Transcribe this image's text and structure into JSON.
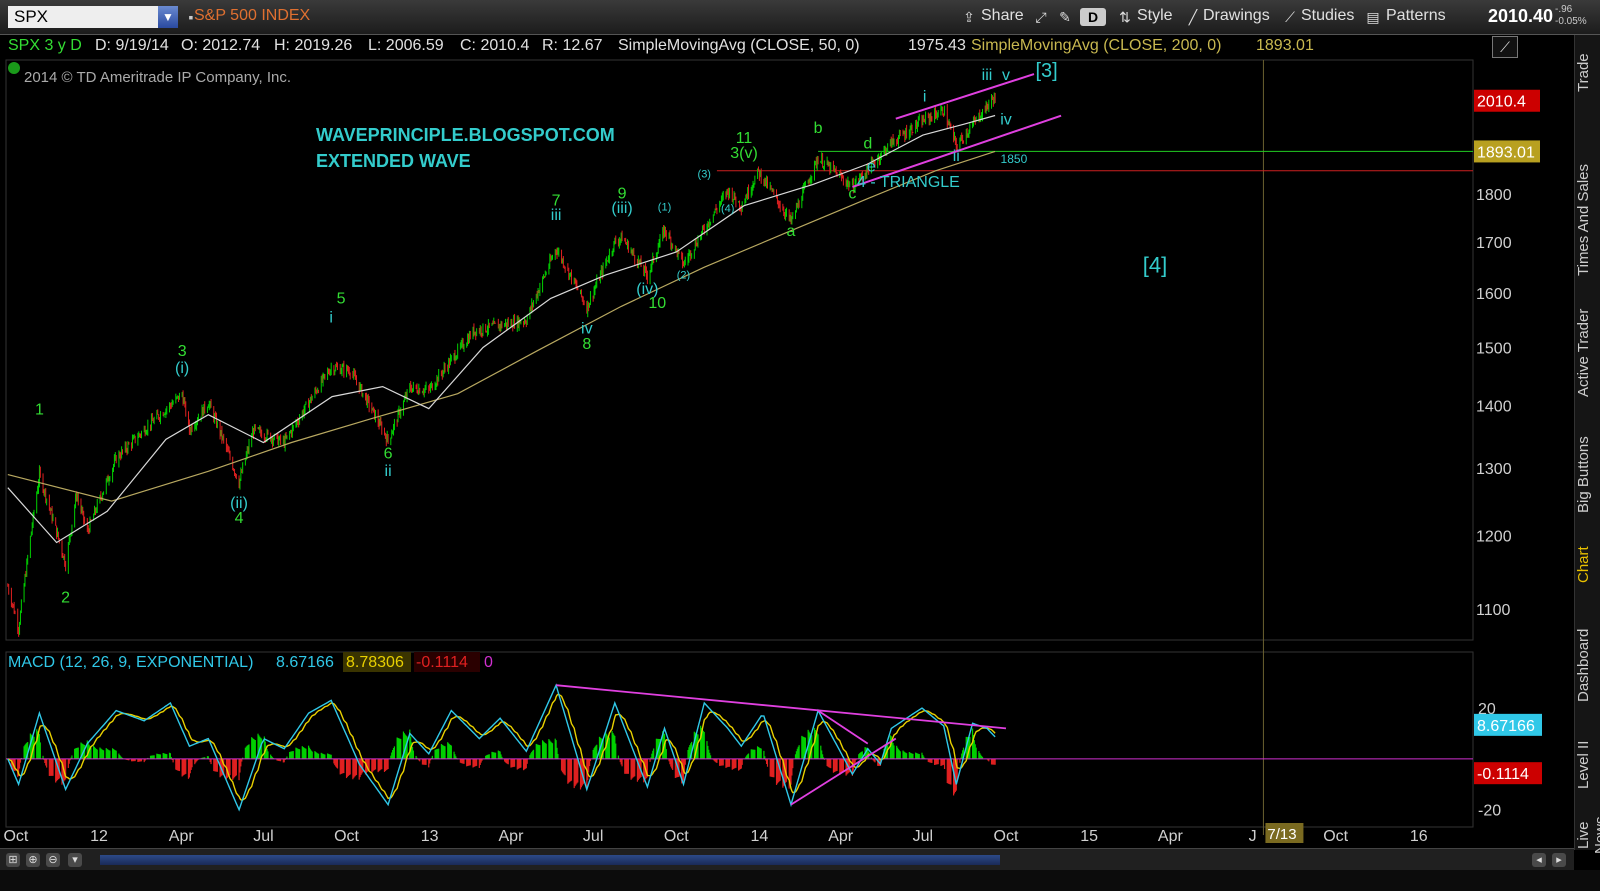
{
  "toolbar": {
    "symbol": "SPX",
    "index_name": "S&P 500 INDEX",
    "share": "Share",
    "style": "Style",
    "drawings": "Drawings",
    "studies": "Studies",
    "patterns": "Patterns",
    "last_price": "2010.40",
    "change": "-.96",
    "change_pct": "-0.05%",
    "d_badge": "D"
  },
  "header": {
    "tf": "SPX 3 y D",
    "date": "D: 9/19/14",
    "open": "O: 2012.74",
    "high": "H: 2019.26",
    "low": "L: 2006.59",
    "close": "C: 2010.4",
    "range": "R: 12.67",
    "sma50_label": "SimpleMovingAvg (CLOSE, 50, 0)",
    "sma50_val": "1975.43",
    "sma200_label": "SimpleMovingAvg (CLOSE, 200, 0)",
    "sma200_val": "1893.01"
  },
  "copyright": "2014 © TD Ameritrade IP Company, Inc.",
  "sidebar": [
    "Trade",
    "Times And Sales",
    "Active Trader",
    "Big Buttons",
    "Chart",
    "Dashboard",
    "Level II",
    "Live News"
  ],
  "colors": {
    "candle_up": "#00d000",
    "candle_down": "#e02020",
    "sma50": "#d8d8d8",
    "sma200": "#b8a860",
    "wave_green": "#33dd33",
    "wave_cyan": "#33cccc",
    "trend_magenta": "#e040e0",
    "macd_line": "#30c8e8",
    "signal_line": "#e8d000"
  },
  "chart_data": {
    "type": "candlestick",
    "price_axis": {
      "ticks": [
        1100,
        1200,
        1300,
        1400,
        1500,
        1600,
        1700,
        1800
      ],
      "ylim": [
        1060,
        2110
      ],
      "scale": "log"
    },
    "x_ticks": [
      "Oct",
      "12",
      "Apr",
      "Jul",
      "Oct",
      "13",
      "Apr",
      "Jul",
      "Oct",
      "14",
      "Apr",
      "Jul",
      "Oct",
      "15",
      "Apr",
      "J",
      "Oct",
      "16"
    ],
    "x_dates": [
      "2011-10-01",
      "2012-01-01",
      "2012-04-01",
      "2012-07-01",
      "2012-10-01",
      "2013-01-01",
      "2013-04-01",
      "2013-07-01",
      "2013-10-01",
      "2014-01-01",
      "2014-04-01",
      "2014-07-01",
      "2014-10-01",
      "2015-01-01",
      "2015-04-01",
      "2015-07-01",
      "2015-10-01",
      "2016-01-01"
    ],
    "xlim": [
      "2011-09-20",
      "2016-03-01"
    ],
    "last_date": "2014-09-19",
    "cursor_date": "7/13",
    "price_series": [
      [
        "2011-09-22",
        1130
      ],
      [
        "2011-10-04",
        1075
      ],
      [
        "2011-10-27",
        1290
      ],
      [
        "2011-11-25",
        1160
      ],
      [
        "2011-12-07",
        1260
      ],
      [
        "2011-12-19",
        1205
      ],
      [
        "2012-01-20",
        1315
      ],
      [
        "2012-03-01",
        1375
      ],
      [
        "2012-04-02",
        1419
      ],
      [
        "2012-04-10",
        1360
      ],
      [
        "2012-05-01",
        1405
      ],
      [
        "2012-06-04",
        1278
      ],
      [
        "2012-06-20",
        1360
      ],
      [
        "2012-07-24",
        1340
      ],
      [
        "2012-09-14",
        1465
      ],
      [
        "2012-10-05",
        1460
      ],
      [
        "2012-11-16",
        1343
      ],
      [
        "2012-12-10",
        1430
      ],
      [
        "2012-12-31",
        1426
      ],
      [
        "2013-02-19",
        1530
      ],
      [
        "2013-04-18",
        1550
      ],
      [
        "2013-05-21",
        1687
      ],
      [
        "2013-06-24",
        1573
      ],
      [
        "2013-07-25",
        1700
      ],
      [
        "2013-08-02",
        1709
      ],
      [
        "2013-08-30",
        1633
      ],
      [
        "2013-09-18",
        1725
      ],
      [
        "2013-10-09",
        1656
      ],
      [
        "2013-11-27",
        1807
      ],
      [
        "2013-12-12",
        1775
      ],
      [
        "2013-12-31",
        1848
      ],
      [
        "2014-02-05",
        1741
      ],
      [
        "2014-03-07",
        1878
      ],
      [
        "2014-04-14",
        1815
      ],
      [
        "2014-05-27",
        1912
      ],
      [
        "2014-06-30",
        1962
      ],
      [
        "2014-07-24",
        1988
      ],
      [
        "2014-08-07",
        1905
      ],
      [
        "2014-09-18",
        2019
      ],
      [
        "2014-09-19",
        2010.4
      ]
    ],
    "sma50_series": [
      [
        "2011-09-22",
        1270
      ],
      [
        "2011-11-15",
        1190
      ],
      [
        "2012-01-10",
        1235
      ],
      [
        "2012-03-15",
        1345
      ],
      [
        "2012-05-01",
        1385
      ],
      [
        "2012-07-01",
        1340
      ],
      [
        "2012-09-15",
        1415
      ],
      [
        "2012-11-10",
        1432
      ],
      [
        "2012-12-31",
        1395
      ],
      [
        "2013-03-01",
        1500
      ],
      [
        "2013-05-15",
        1590
      ],
      [
        "2013-07-15",
        1635
      ],
      [
        "2013-10-01",
        1680
      ],
      [
        "2013-12-15",
        1775
      ],
      [
        "2014-03-01",
        1820
      ],
      [
        "2014-05-01",
        1865
      ],
      [
        "2014-07-01",
        1930
      ],
      [
        "2014-08-15",
        1955
      ],
      [
        "2014-09-19",
        1975.43
      ]
    ],
    "sma200_series": [
      [
        "2011-09-22",
        1290
      ],
      [
        "2012-01-15",
        1250
      ],
      [
        "2012-05-01",
        1295
      ],
      [
        "2012-08-01",
        1340
      ],
      [
        "2012-11-01",
        1380
      ],
      [
        "2013-02-01",
        1420
      ],
      [
        "2013-05-01",
        1495
      ],
      [
        "2013-08-01",
        1575
      ],
      [
        "2013-11-01",
        1650
      ],
      [
        "2014-02-01",
        1720
      ],
      [
        "2014-05-01",
        1790
      ],
      [
        "2014-07-15",
        1850
      ],
      [
        "2014-09-19",
        1893.01
      ]
    ],
    "horizontal_lines": [
      {
        "value": 1893.01,
        "color": "#22cc22",
        "label": "1893.01"
      },
      {
        "value": 1850,
        "color": "#cc2020",
        "label": "1850",
        "label_text": "1850"
      }
    ],
    "price_labels": [
      {
        "value": 2010.4,
        "text": "2010.4",
        "bg": "#cc0000"
      },
      {
        "value": 1893.01,
        "text": "1893.01",
        "bg": "#b8a020"
      }
    ],
    "annotations": [
      {
        "date": "2011-10-27",
        "value": 1385,
        "text": "1",
        "color": "#33dd33",
        "size": 16
      },
      {
        "date": "2011-11-25",
        "value": 1108,
        "text": "2",
        "color": "#33dd33",
        "size": 16
      },
      {
        "date": "2012-04-02",
        "value": 1485,
        "text": "3",
        "color": "#33dd33",
        "size": 16
      },
      {
        "date": "2012-04-02",
        "value": 1455,
        "text": "(i)",
        "color": "#33cccc",
        "size": 16
      },
      {
        "date": "2012-06-04",
        "value": 1240,
        "text": "(ii)",
        "color": "#33cccc",
        "size": 16
      },
      {
        "date": "2012-06-04",
        "value": 1218,
        "text": "4",
        "color": "#33dd33",
        "size": 16
      },
      {
        "date": "2012-09-14",
        "value": 1545,
        "text": "i",
        "color": "#33cccc",
        "size": 16
      },
      {
        "date": "2012-09-25",
        "value": 1580,
        "text": "5",
        "color": "#33dd33",
        "size": 16
      },
      {
        "date": "2012-11-16",
        "value": 1315,
        "text": "6",
        "color": "#33dd33",
        "size": 16
      },
      {
        "date": "2012-11-16",
        "value": 1288,
        "text": "ii",
        "color": "#33cccc",
        "size": 16
      },
      {
        "date": "2013-05-21",
        "value": 1775,
        "text": "7",
        "color": "#33dd33",
        "size": 16
      },
      {
        "date": "2013-05-21",
        "value": 1745,
        "text": "iii",
        "color": "#33cccc",
        "size": 16
      },
      {
        "date": "2013-06-24",
        "value": 1525,
        "text": "iv",
        "color": "#33cccc",
        "size": 16
      },
      {
        "date": "2013-06-24",
        "value": 1497,
        "text": "8",
        "color": "#33dd33",
        "size": 16
      },
      {
        "date": "2013-08-02",
        "value": 1790,
        "text": "9",
        "color": "#33dd33",
        "size": 16
      },
      {
        "date": "2013-08-02",
        "value": 1760,
        "text": "(iii)",
        "color": "#33cccc",
        "size": 16
      },
      {
        "date": "2013-08-30",
        "value": 1598,
        "text": "(iv)",
        "color": "#33cccc",
        "size": 16
      },
      {
        "date": "2013-09-10",
        "value": 1572,
        "text": "10",
        "color": "#33dd33",
        "size": 16
      },
      {
        "date": "2013-09-18",
        "value": 1765,
        "text": "(1)",
        "color": "#33cccc",
        "size": 11
      },
      {
        "date": "2013-10-09",
        "value": 1628,
        "text": "(2)",
        "color": "#33cccc",
        "size": 11
      },
      {
        "date": "2013-11-01",
        "value": 1835,
        "text": "(3)",
        "color": "#33cccc",
        "size": 11
      },
      {
        "date": "2013-11-27",
        "value": 1762,
        "text": "(4)",
        "color": "#33cccc",
        "size": 11
      },
      {
        "date": "2013-12-15",
        "value": 1912,
        "text": "11",
        "color": "#33dd33",
        "size": 16
      },
      {
        "date": "2013-12-15",
        "value": 1878,
        "text": "3(v)",
        "color": "#33dd33",
        "size": 16
      },
      {
        "date": "2014-02-05",
        "value": 1712,
        "text": "a",
        "color": "#33dd33",
        "size": 16
      },
      {
        "date": "2014-03-07",
        "value": 1935,
        "text": "b",
        "color": "#33dd33",
        "size": 16
      },
      {
        "date": "2014-04-14",
        "value": 1790,
        "text": "c",
        "color": "#33dd33",
        "size": 16
      },
      {
        "date": "2014-05-01",
        "value": 1900,
        "text": "d",
        "color": "#33dd33",
        "size": 16
      },
      {
        "date": "2014-05-05",
        "value": 1848,
        "text": "e",
        "color": "#33cccc",
        "size": 16
      },
      {
        "date": "2014-06-15",
        "value": 1815,
        "text": "4 - TRIANGLE",
        "color": "#33cccc",
        "size": 16
      },
      {
        "date": "2014-07-03",
        "value": 2008,
        "text": "i",
        "color": "#33cccc",
        "size": 16
      },
      {
        "date": "2014-08-07",
        "value": 1872,
        "text": "ii",
        "color": "#33cccc",
        "size": 16
      },
      {
        "date": "2014-09-10",
        "value": 2060,
        "text": "iii",
        "color": "#33cccc",
        "size": 16
      },
      {
        "date": "2014-10-01",
        "value": 1955,
        "text": "iv",
        "color": "#33cccc",
        "size": 16
      },
      {
        "date": "2014-10-01",
        "value": 2060,
        "text": "v",
        "color": "#33cccc",
        "size": 16
      },
      {
        "date": "2014-11-15",
        "value": 2068,
        "text": "[3]",
        "color": "#33cccc",
        "size": 20
      },
      {
        "date": "2015-03-15",
        "value": 1640,
        "text": "[4]",
        "color": "#33cccc",
        "size": 22
      }
    ],
    "blog_text": {
      "line1": "WAVEPRINCIPLE.BLOGSPOT.COM",
      "line2": "EXTENDED WAVE",
      "color": "#33cccc"
    },
    "trendlines": [
      {
        "from": [
          "2014-04-14",
          1815
        ],
        "to": [
          "2014-12-01",
          1975
        ],
        "color": "#e040e0"
      },
      {
        "from": [
          "2014-06-01",
          1968
        ],
        "to": [
          "2014-11-01",
          2075
        ],
        "color": "#e040e0"
      }
    ],
    "macd": {
      "label": "MACD (12, 26, 9, EXPONENTIAL)",
      "value": "8.67166",
      "avg": "8.78306",
      "diff": "-0.1114",
      "zero": "0",
      "ticks": [
        20,
        -20
      ],
      "ylim": [
        -26,
        33
      ],
      "value_labels": [
        {
          "value": 8.67166,
          "text": "8.67166",
          "bg": "#30c8e8"
        },
        {
          "value": -0.1114,
          "text": "-0.1114",
          "bg": "#cc0000"
        }
      ],
      "macd_series": [
        [
          "2011-09-22",
          0
        ],
        [
          "2011-10-04",
          -10
        ],
        [
          "2011-10-27",
          18
        ],
        [
          "2011-11-25",
          -12
        ],
        [
          "2011-12-19",
          6
        ],
        [
          "2012-01-20",
          19
        ],
        [
          "2012-02-20",
          15
        ],
        [
          "2012-03-20",
          22
        ],
        [
          "2012-04-10",
          5
        ],
        [
          "2012-05-01",
          8
        ],
        [
          "2012-06-04",
          -20
        ],
        [
          "2012-07-01",
          8
        ],
        [
          "2012-07-24",
          4
        ],
        [
          "2012-08-20",
          18
        ],
        [
          "2012-09-14",
          23
        ],
        [
          "2012-10-15",
          -2
        ],
        [
          "2012-11-16",
          -18
        ],
        [
          "2012-12-10",
          10
        ],
        [
          "2012-12-31",
          2
        ],
        [
          "2013-01-25",
          19
        ],
        [
          "2013-02-25",
          8
        ],
        [
          "2013-03-20",
          16
        ],
        [
          "2013-04-18",
          3
        ],
        [
          "2013-05-21",
          29
        ],
        [
          "2013-06-24",
          -12
        ],
        [
          "2013-07-25",
          22
        ],
        [
          "2013-08-30",
          -11
        ],
        [
          "2013-09-18",
          12
        ],
        [
          "2013-10-09",
          -10
        ],
        [
          "2013-11-01",
          22
        ],
        [
          "2013-11-27",
          12
        ],
        [
          "2013-12-12",
          5
        ],
        [
          "2014-01-05",
          18
        ],
        [
          "2014-02-05",
          -18
        ],
        [
          "2014-03-07",
          19
        ],
        [
          "2014-04-14",
          -6
        ],
        [
          "2014-05-01",
          4
        ],
        [
          "2014-05-15",
          -2
        ],
        [
          "2014-05-27",
          12
        ],
        [
          "2014-06-30",
          20
        ],
        [
          "2014-07-24",
          13
        ],
        [
          "2014-08-07",
          -10
        ],
        [
          "2014-08-25",
          14
        ],
        [
          "2014-09-10",
          12
        ],
        [
          "2014-09-19",
          8.67
        ]
      ],
      "trendlines": [
        {
          "from": [
            "2013-05-21",
            29
          ],
          "to": [
            "2014-10-01",
            12
          ],
          "color": "#e040e0"
        },
        {
          "from": [
            "2014-02-05",
            -18
          ],
          "to": [
            "2014-06-01",
            8
          ],
          "color": "#e040e0"
        },
        {
          "from": [
            "2014-03-07",
            19
          ],
          "to": [
            "2014-05-01",
            6
          ],
          "color": "#e040e0"
        }
      ]
    }
  }
}
